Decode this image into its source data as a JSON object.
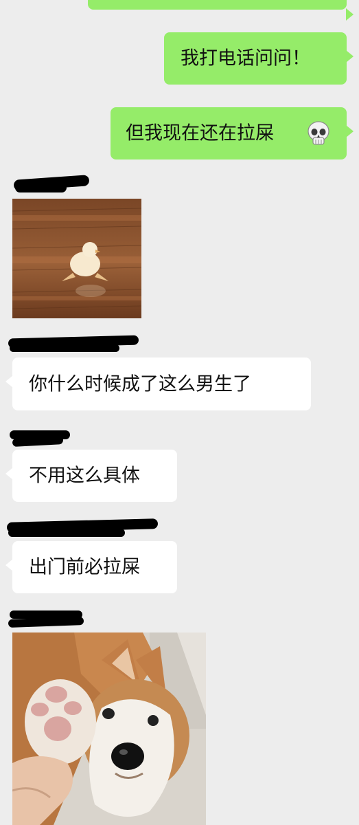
{
  "messages": [
    {
      "id": "m0",
      "side": "out",
      "kind": "text",
      "text": ""
    },
    {
      "id": "m1",
      "side": "out",
      "kind": "text",
      "text": "我打电话问问！"
    },
    {
      "id": "m2",
      "side": "out",
      "kind": "text",
      "text": "但我现在还在拉屎",
      "emoji": "skull-emoji"
    },
    {
      "id": "m3",
      "side": "in",
      "kind": "image",
      "image": "duckling-on-floor-sticker"
    },
    {
      "id": "m4",
      "side": "in",
      "kind": "text",
      "text": "你什么时候成了这么男生了"
    },
    {
      "id": "m5",
      "side": "in",
      "kind": "text",
      "text": "不用这么具体"
    },
    {
      "id": "m6",
      "side": "in",
      "kind": "text",
      "text": "出门前必拉屎"
    },
    {
      "id": "m7",
      "side": "in",
      "kind": "image",
      "image": "corgi-puppy-paw-photo"
    }
  ],
  "colors": {
    "background": "#ededed",
    "outgoing_bubble": "#95ec69",
    "incoming_bubble": "#ffffff",
    "redaction": "#000000"
  }
}
